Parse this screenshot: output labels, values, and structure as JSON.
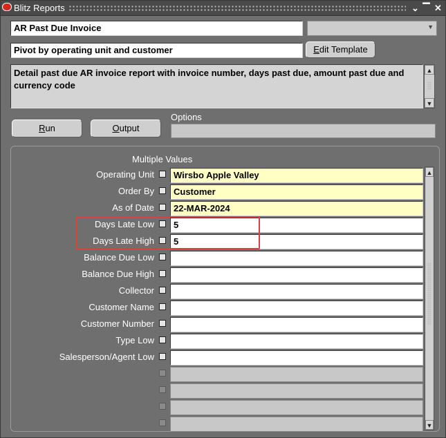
{
  "window": {
    "title": "Blitz Reports"
  },
  "report": {
    "name": "AR Past Due Invoice",
    "template": "Pivot by operating unit and customer",
    "description": "Detail past due AR invoice report with invoice number, days past due, amount past due and currency code",
    "edit_template_label": "Edit Template"
  },
  "actions": {
    "run_label": "Run",
    "output_label": "Output",
    "options_label": "Options"
  },
  "parameters": {
    "multiple_values_label": "Multiple Values",
    "rows": [
      {
        "label": "Operating Unit",
        "value": "Wirsbo Apple Valley",
        "required": true
      },
      {
        "label": "Order By",
        "value": "Customer",
        "required": true
      },
      {
        "label": "As of Date",
        "value": "22-MAR-2024",
        "required": true
      },
      {
        "label": "Days Late Low",
        "value": "5",
        "required": false
      },
      {
        "label": "Days Late High",
        "value": "5",
        "required": false
      },
      {
        "label": "Balance Due Low",
        "value": "",
        "required": false
      },
      {
        "label": "Balance Due High",
        "value": "",
        "required": false
      },
      {
        "label": "Collector",
        "value": "",
        "required": false
      },
      {
        "label": "Customer Name",
        "value": "",
        "required": false
      },
      {
        "label": "Customer Number",
        "value": "",
        "required": false
      },
      {
        "label": "Type Low",
        "value": "",
        "required": false
      },
      {
        "label": "Salesperson/Agent Low",
        "value": "",
        "required": false
      },
      {
        "label": "",
        "value": "",
        "required": false
      },
      {
        "label": "",
        "value": "",
        "required": false
      },
      {
        "label": "",
        "value": "",
        "required": false
      },
      {
        "label": "",
        "value": "",
        "required": false
      }
    ]
  },
  "colors": {
    "background": "#6f6f6f",
    "required_field": "#ffffc4",
    "highlight": "#d9413a"
  }
}
